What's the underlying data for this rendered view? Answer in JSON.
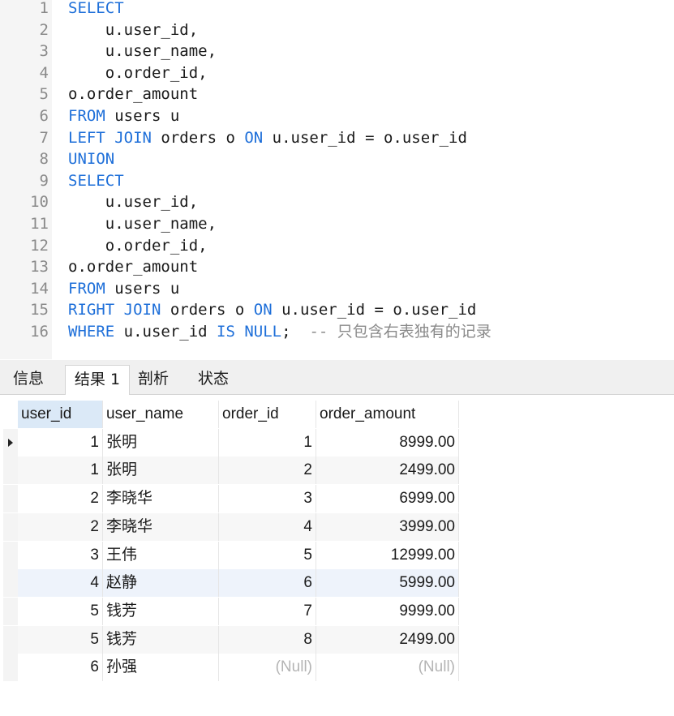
{
  "editor": {
    "lines": [
      {
        "n": "1",
        "segs": [
          {
            "t": "SELECT",
            "k": "kw"
          }
        ]
      },
      {
        "n": "2",
        "segs": [
          {
            "t": "    u.user_id,",
            "k": "tx"
          }
        ]
      },
      {
        "n": "3",
        "segs": [
          {
            "t": "    u.user_name,",
            "k": "tx"
          }
        ]
      },
      {
        "n": "4",
        "segs": [
          {
            "t": "    o.order_id,",
            "k": "tx"
          }
        ]
      },
      {
        "n": "5",
        "segs": [
          {
            "t": "o.order_amount",
            "k": "tx"
          }
        ]
      },
      {
        "n": "6",
        "segs": [
          {
            "t": "FROM",
            "k": "kw"
          },
          {
            "t": " users u",
            "k": "tx"
          }
        ]
      },
      {
        "n": "7",
        "segs": [
          {
            "t": "LEFT JOIN",
            "k": "kw"
          },
          {
            "t": " orders o ",
            "k": "tx"
          },
          {
            "t": "ON",
            "k": "kw"
          },
          {
            "t": " u.user_id = o.user_id",
            "k": "tx"
          }
        ]
      },
      {
        "n": "8",
        "segs": [
          {
            "t": "UNION",
            "k": "kw"
          }
        ]
      },
      {
        "n": "9",
        "segs": [
          {
            "t": "SELECT",
            "k": "kw"
          }
        ]
      },
      {
        "n": "10",
        "segs": [
          {
            "t": "    u.user_id,",
            "k": "tx"
          }
        ]
      },
      {
        "n": "11",
        "segs": [
          {
            "t": "    u.user_name,",
            "k": "tx"
          }
        ]
      },
      {
        "n": "12",
        "segs": [
          {
            "t": "    o.order_id,",
            "k": "tx"
          }
        ]
      },
      {
        "n": "13",
        "segs": [
          {
            "t": "o.order_amount",
            "k": "tx"
          }
        ]
      },
      {
        "n": "14",
        "segs": [
          {
            "t": "FROM",
            "k": "kw"
          },
          {
            "t": " users u",
            "k": "tx"
          }
        ]
      },
      {
        "n": "15",
        "segs": [
          {
            "t": "RIGHT JOIN",
            "k": "kw"
          },
          {
            "t": " orders o ",
            "k": "tx"
          },
          {
            "t": "ON",
            "k": "kw"
          },
          {
            "t": " u.user_id = o.user_id",
            "k": "tx"
          }
        ]
      },
      {
        "n": "16",
        "segs": [
          {
            "t": "WHERE",
            "k": "kw"
          },
          {
            "t": " u.user_id ",
            "k": "tx"
          },
          {
            "t": "IS NULL",
            "k": "kw"
          },
          {
            "t": ";  ",
            "k": "tx"
          },
          {
            "t": "-- 只包含右表独有的记录",
            "k": "cm"
          }
        ]
      }
    ],
    "colors": {
      "keyword": "#1e6fd9",
      "text": "#1a1a1a",
      "comment": "#8a8a8a"
    }
  },
  "tabs": [
    {
      "label": "信息",
      "active": false
    },
    {
      "label": "结果 1",
      "active": true
    },
    {
      "label": "剖析",
      "active": false
    },
    {
      "label": "状态",
      "active": false
    }
  ],
  "results": {
    "columns": [
      "user_id",
      "user_name",
      "order_id",
      "order_amount"
    ],
    "selected_column": "user_id",
    "current_row": 0,
    "rows": [
      [
        "1",
        "张明",
        "1",
        "8999.00"
      ],
      [
        "1",
        "张明",
        "2",
        "2499.00"
      ],
      [
        "2",
        "李晓华",
        "3",
        "6999.00"
      ],
      [
        "2",
        "李晓华",
        "4",
        "3999.00"
      ],
      [
        "3",
        "王伟",
        "5",
        "12999.00"
      ],
      [
        "4",
        "赵静",
        "6",
        "5999.00"
      ],
      [
        "5",
        "钱芳",
        "7",
        "9999.00"
      ],
      [
        "5",
        "钱芳",
        "8",
        "2499.00"
      ],
      [
        "6",
        "孙强",
        "(Null)",
        "(Null)"
      ]
    ],
    "null_text": "(Null)",
    "row_colors": {
      "even": "#ffffff",
      "odd": "#f7f7f7",
      "highlight": "#eef3fb"
    },
    "highlight_row": 5
  }
}
